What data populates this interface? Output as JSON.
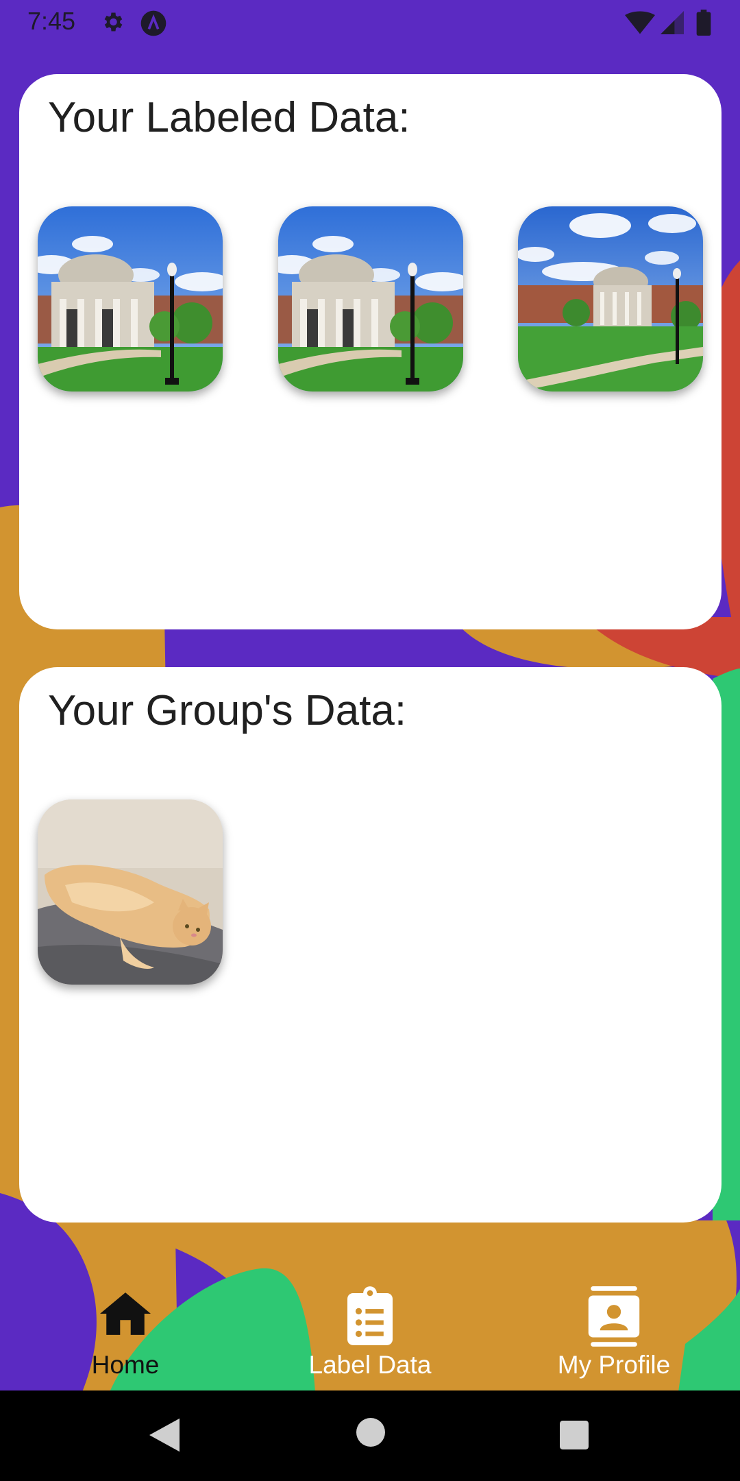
{
  "status_bar": {
    "time": "7:45",
    "left_icons": [
      "settings-gear-icon",
      "app-notification-icon"
    ],
    "right_icons": [
      "wifi-icon",
      "cellular-signal-icon",
      "battery-icon"
    ]
  },
  "colors": {
    "purple": "#5b2ac2",
    "orange": "#d29430",
    "red": "#cd4435",
    "green": "#2ec873",
    "card": "#ffffff"
  },
  "labeled_section": {
    "title": "Your Labeled Data:",
    "images": [
      {
        "subject": "domed building with columns and lamp post"
      },
      {
        "subject": "domed building with columns and lamp post"
      },
      {
        "subject": "campus building with dome and lawn"
      }
    ]
  },
  "group_section": {
    "title": "Your Group's Data:",
    "images": [
      {
        "subject": "orange cat lying on cushion"
      }
    ]
  },
  "bottom_nav": {
    "items": [
      {
        "label": "Home",
        "icon": "home-icon",
        "active": true
      },
      {
        "label": "Label Data",
        "icon": "clipboard-list-icon",
        "active": false
      },
      {
        "label": "My Profile",
        "icon": "contact-card-icon",
        "active": false
      }
    ]
  },
  "system_nav": {
    "buttons": [
      "back-icon",
      "home-circle-icon",
      "recents-square-icon"
    ]
  }
}
